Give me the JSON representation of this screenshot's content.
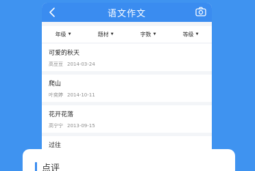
{
  "header": {
    "title": "语文作文",
    "back_icon": "chevron-left-icon",
    "camera_icon": "camera-icon"
  },
  "filters": [
    {
      "label": "年级"
    },
    {
      "label": "题材"
    },
    {
      "label": "字数"
    },
    {
      "label": "等级"
    }
  ],
  "essays": [
    {
      "title": "可爱的秋天",
      "author": "高豆豆",
      "date": "2014-03-24"
    },
    {
      "title": "爬山",
      "author": "叶奕婷",
      "date": "2014-10-11"
    },
    {
      "title": "花开花落",
      "author": "高宁宁",
      "date": "2013-09-15"
    },
    {
      "title": "过往",
      "author": "",
      "date": ""
    }
  ],
  "review_sheet": {
    "title": "点评"
  },
  "colors": {
    "background": "#3f93f0",
    "accent": "#3a8cf0",
    "card": "#ffffff",
    "muted_text": "#8c8c8c"
  }
}
